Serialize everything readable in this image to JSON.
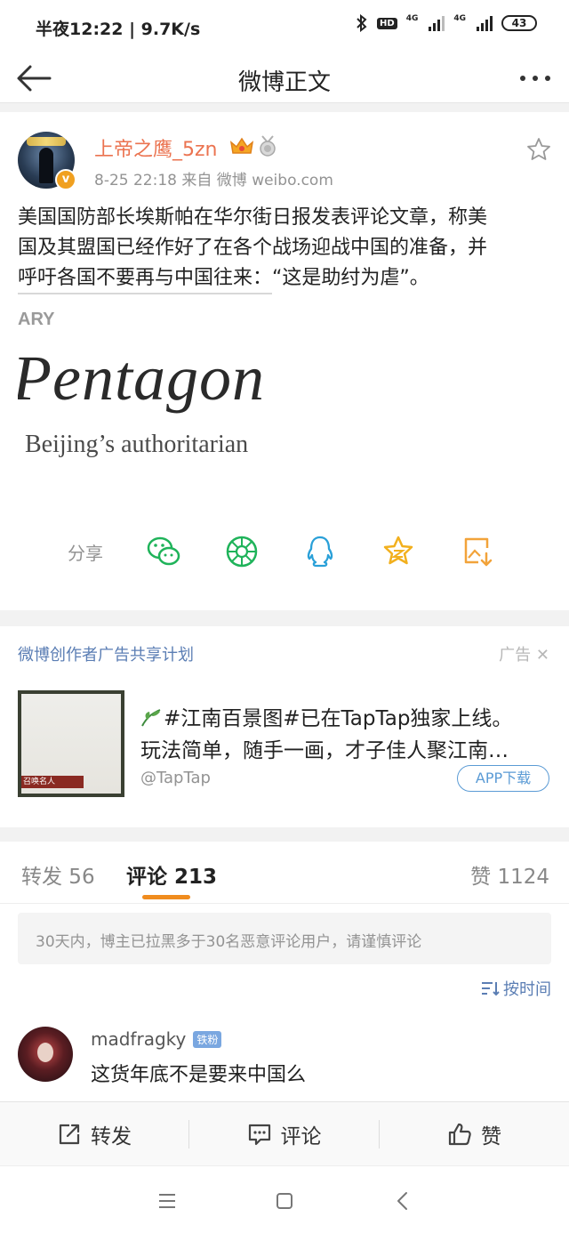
{
  "status": {
    "time": "半夜12:22 | 9.7K/s",
    "battery": "43",
    "hd": "HD",
    "net1": "4G",
    "net2": "4G"
  },
  "nav": {
    "title": "微博正文"
  },
  "post": {
    "username": "上帝之鹰_5zn",
    "meta": "8-25 22:18  来自 微博 weibo.com",
    "text_line1": "美国国防部长埃斯帕在华尔街日报发表评论文章，称美",
    "text_line2": "国及其盟国已经作好了在各个战场迎战中国的准备，并",
    "text_line3_underlined": "呼吁各国不要再与中国往来：",
    "text_line3_rest": "“这是助纣为虐”。",
    "image_text": {
      "top": "ARY",
      "headline": "Pentagon",
      "sub": "Beijing’s authoritarian"
    },
    "share_label": "分享",
    "share_targets": [
      "wechat-icon",
      "moments-icon",
      "qq-icon",
      "qzone-icon",
      "save-image-icon"
    ]
  },
  "ad": {
    "program": "微博创作者广告共享计划",
    "tag": "广告",
    "line1": "#江南百景图#已在TapTap独家上线。",
    "line2": "玩法简单，随手一画，才子佳人聚江南…",
    "source": "@TapTap",
    "button": "APP下载",
    "thumb_label": "召唤名人"
  },
  "tabs": {
    "repost": "转发 56",
    "comment": "评论 213",
    "like": "赞 1124"
  },
  "notice": "30天内，博主已拉黑多于30名恶意评论用户，请谨慎评论",
  "sort": "按时间",
  "comment": {
    "user": "madfragky",
    "badge": "铁粉",
    "text": "这货年底不是要来中国么"
  },
  "actions": {
    "repost": "转发",
    "comment": "评论",
    "like": "赞"
  },
  "colors": {
    "username": "#eb7350",
    "link": "#5b7eb4",
    "accent": "#f08c1e",
    "share_green": "#1fb35a",
    "share_blue": "#2aa0d8",
    "share_gold": "#f2b01e"
  }
}
